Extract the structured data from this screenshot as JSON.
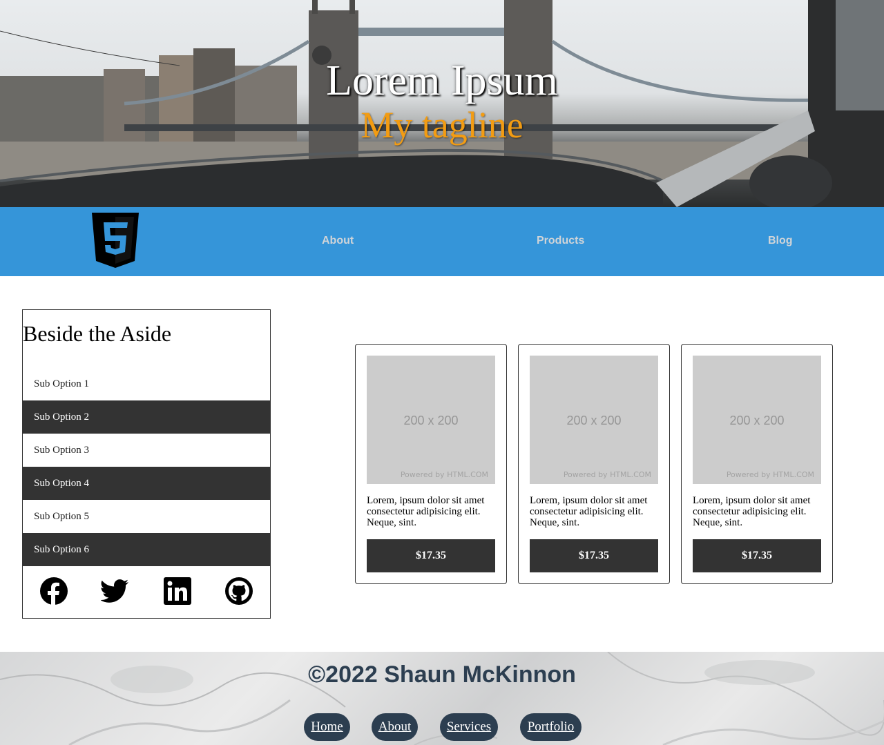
{
  "hero": {
    "title": "Lorem Ipsum",
    "tagline": "My tagline",
    "title_color": "#ffffff",
    "tagline_color": "#f39c12"
  },
  "nav": {
    "logo_icon": "html5-logo-icon",
    "items": [
      {
        "label": "About"
      },
      {
        "label": "Products"
      },
      {
        "label": "Blog"
      }
    ],
    "background": "#3595d9"
  },
  "aside": {
    "heading": "Beside the Aside",
    "options": [
      {
        "label": "Sub Option 1"
      },
      {
        "label": "Sub Option 2"
      },
      {
        "label": "Sub Option 3"
      },
      {
        "label": "Sub Option 4"
      },
      {
        "label": "Sub Option 5"
      },
      {
        "label": "Sub Option 6"
      }
    ],
    "social_icons": [
      "facebook-icon",
      "twitter-icon",
      "linkedin-icon",
      "github-icon"
    ]
  },
  "products": [
    {
      "image_text": "200 x 200",
      "image_credit": "Powered by HTML.COM",
      "description": "Lorem, ipsum dolor sit amet consectetur adipisicing elit. Neque, sint.",
      "price": "$17.35"
    },
    {
      "image_text": "200 x 200",
      "image_credit": "Powered by HTML.COM",
      "description": "Lorem, ipsum dolor sit amet consectetur adipisicing elit. Neque, sint.",
      "price": "$17.35"
    },
    {
      "image_text": "200 x 200",
      "image_credit": "Powered by HTML.COM",
      "description": "Lorem, ipsum dolor sit amet consectetur adipisicing elit. Neque, sint.",
      "price": "$17.35"
    }
  ],
  "footer": {
    "copyright": "©2022 Shaun McKinnon",
    "links": [
      {
        "label": "Home"
      },
      {
        "label": "About"
      },
      {
        "label": "Services"
      },
      {
        "label": "Portfolio"
      }
    ],
    "accent": "#2c3e50"
  }
}
